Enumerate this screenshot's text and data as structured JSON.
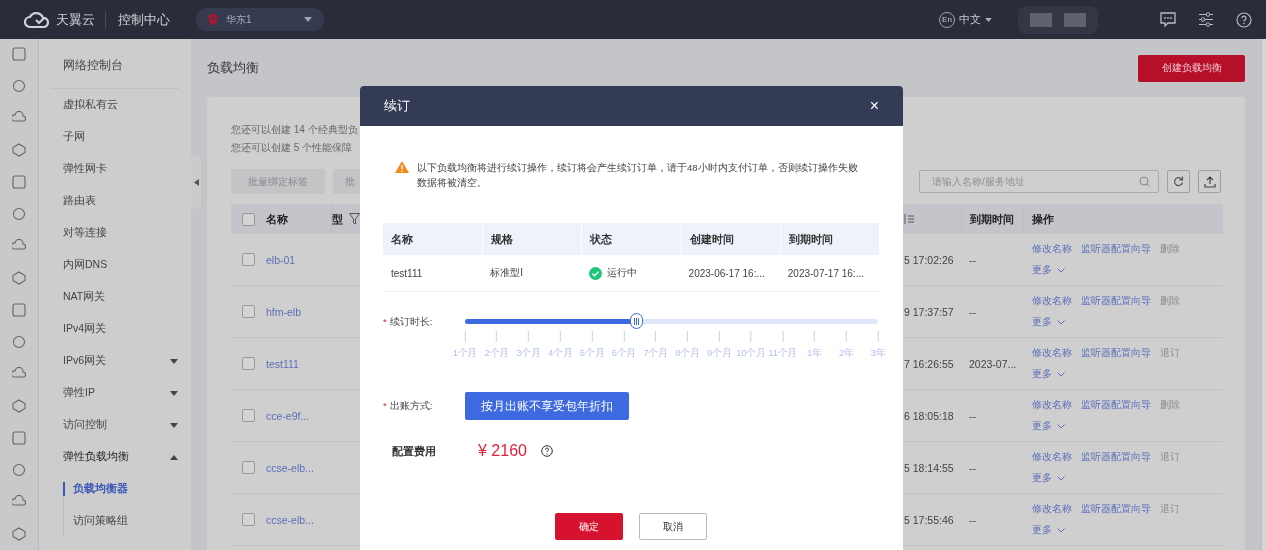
{
  "topbar": {
    "brand": "天翼云",
    "console": "控制中心",
    "region": "华东1",
    "language_badge": "En",
    "language": "中文"
  },
  "sidebar": {
    "title": "网络控制台",
    "items": [
      {
        "label": "虚拟私有云",
        "selected": false
      },
      {
        "label": "子网",
        "selected": false
      },
      {
        "label": "弹性网卡",
        "selected": false
      },
      {
        "label": "路由表",
        "selected": false
      },
      {
        "label": "对等连接",
        "selected": false
      },
      {
        "label": "内网DNS",
        "selected": false
      },
      {
        "label": "NAT网关",
        "selected": false
      },
      {
        "label": "IPv4网关",
        "selected": false
      },
      {
        "label": "IPv6网关",
        "expanded": false,
        "selected": false
      },
      {
        "label": "弹性IP",
        "expanded": false,
        "selected": false
      },
      {
        "label": "访问控制",
        "expanded": false,
        "selected": false
      },
      {
        "label": "弹性负载均衡",
        "expanded": true,
        "selected": false,
        "children": [
          {
            "label": "负载均衡器",
            "selected": true
          },
          {
            "label": "访问策略组",
            "selected": false
          }
        ]
      }
    ]
  },
  "page": {
    "title": "负载均衡",
    "create_button": "创建负载均衡",
    "quota_lines": [
      "您还可以创建 14 个经典型负",
      "您还可以创建 5 个性能保障"
    ],
    "toolbar_buttons": [
      "批量绑定标签",
      "批"
    ],
    "search": {
      "placeholder": "请输入名称/服务地址"
    },
    "table": {
      "all_checked": false,
      "columns": [
        "名称",
        "型",
        "",
        "到期时间",
        "操作"
      ],
      "rows": [
        {
          "name": "elb-01",
          "checked": false,
          "created": "5 17:02:26",
          "expiry": "--",
          "actions": [
            "修改名称",
            "监听器配置向导",
            "删除"
          ],
          "more": "更多"
        },
        {
          "name": "hfm-elb",
          "checked": false,
          "created": "9 17:37:57",
          "expiry": "--",
          "actions": [
            "修改名称",
            "监听器配置向导",
            "删除"
          ],
          "more": "更多"
        },
        {
          "name": "test111",
          "checked": false,
          "created": "7 16:26:55",
          "expiry": "2023-07...",
          "actions": [
            "修改名称",
            "监听器配置向导",
            "退订"
          ],
          "more": "更多"
        },
        {
          "name": "cce-e9f...",
          "checked": false,
          "created": "6 18:05:18",
          "expiry": "--",
          "actions": [
            "修改名称",
            "监听器配置向导",
            "删除"
          ],
          "more": "更多"
        },
        {
          "name": "ccse-elb...",
          "checked": false,
          "created": "5 18:14:55",
          "expiry": "--",
          "actions": [
            "修改名称",
            "监听器配置向导",
            "退订"
          ],
          "more": "更多"
        },
        {
          "name": "ccse-elb...",
          "checked": false,
          "created": "5 17:55:46",
          "expiry": "--",
          "actions": [
            "修改名称",
            "监听器配置向导",
            "退订"
          ],
          "more": "更多"
        }
      ]
    }
  },
  "dialog": {
    "title": "续订",
    "close": "×",
    "warning": "以下负载均衡将进行续订操作，续订将会产生续订订单，请于48小时内支付订单，否则续订操作失败数据将被清空。",
    "table": {
      "columns": [
        "名称",
        "规格",
        "状态",
        "创建时间",
        "到期时间"
      ],
      "rows": [
        {
          "name": "test111",
          "spec": "标准型I",
          "status": "运行中",
          "status_ok": true,
          "created": "2023-06-17 16:...",
          "expiry": "2023-07-17 16:..."
        }
      ]
    },
    "duration": {
      "required_mark": "*",
      "label": "续订时长:",
      "level": 0.417,
      "ticks": [
        "1个月",
        "2个月",
        "3个月",
        "4个月",
        "5个月",
        "6个月",
        "7个月",
        "8个月",
        "9个月",
        "10个月",
        "11个月",
        "1年",
        "2年",
        "3年"
      ]
    },
    "billing": {
      "required_mark": "*",
      "label": "出账方式:",
      "option": "按月出账不享受包年折扣"
    },
    "fee": {
      "label": "配置费用",
      "amount": "¥ 2160"
    },
    "buttons": [
      {
        "label": "确定",
        "kind": "primary"
      },
      {
        "label": "取消",
        "kind": "secondary"
      }
    ]
  }
}
